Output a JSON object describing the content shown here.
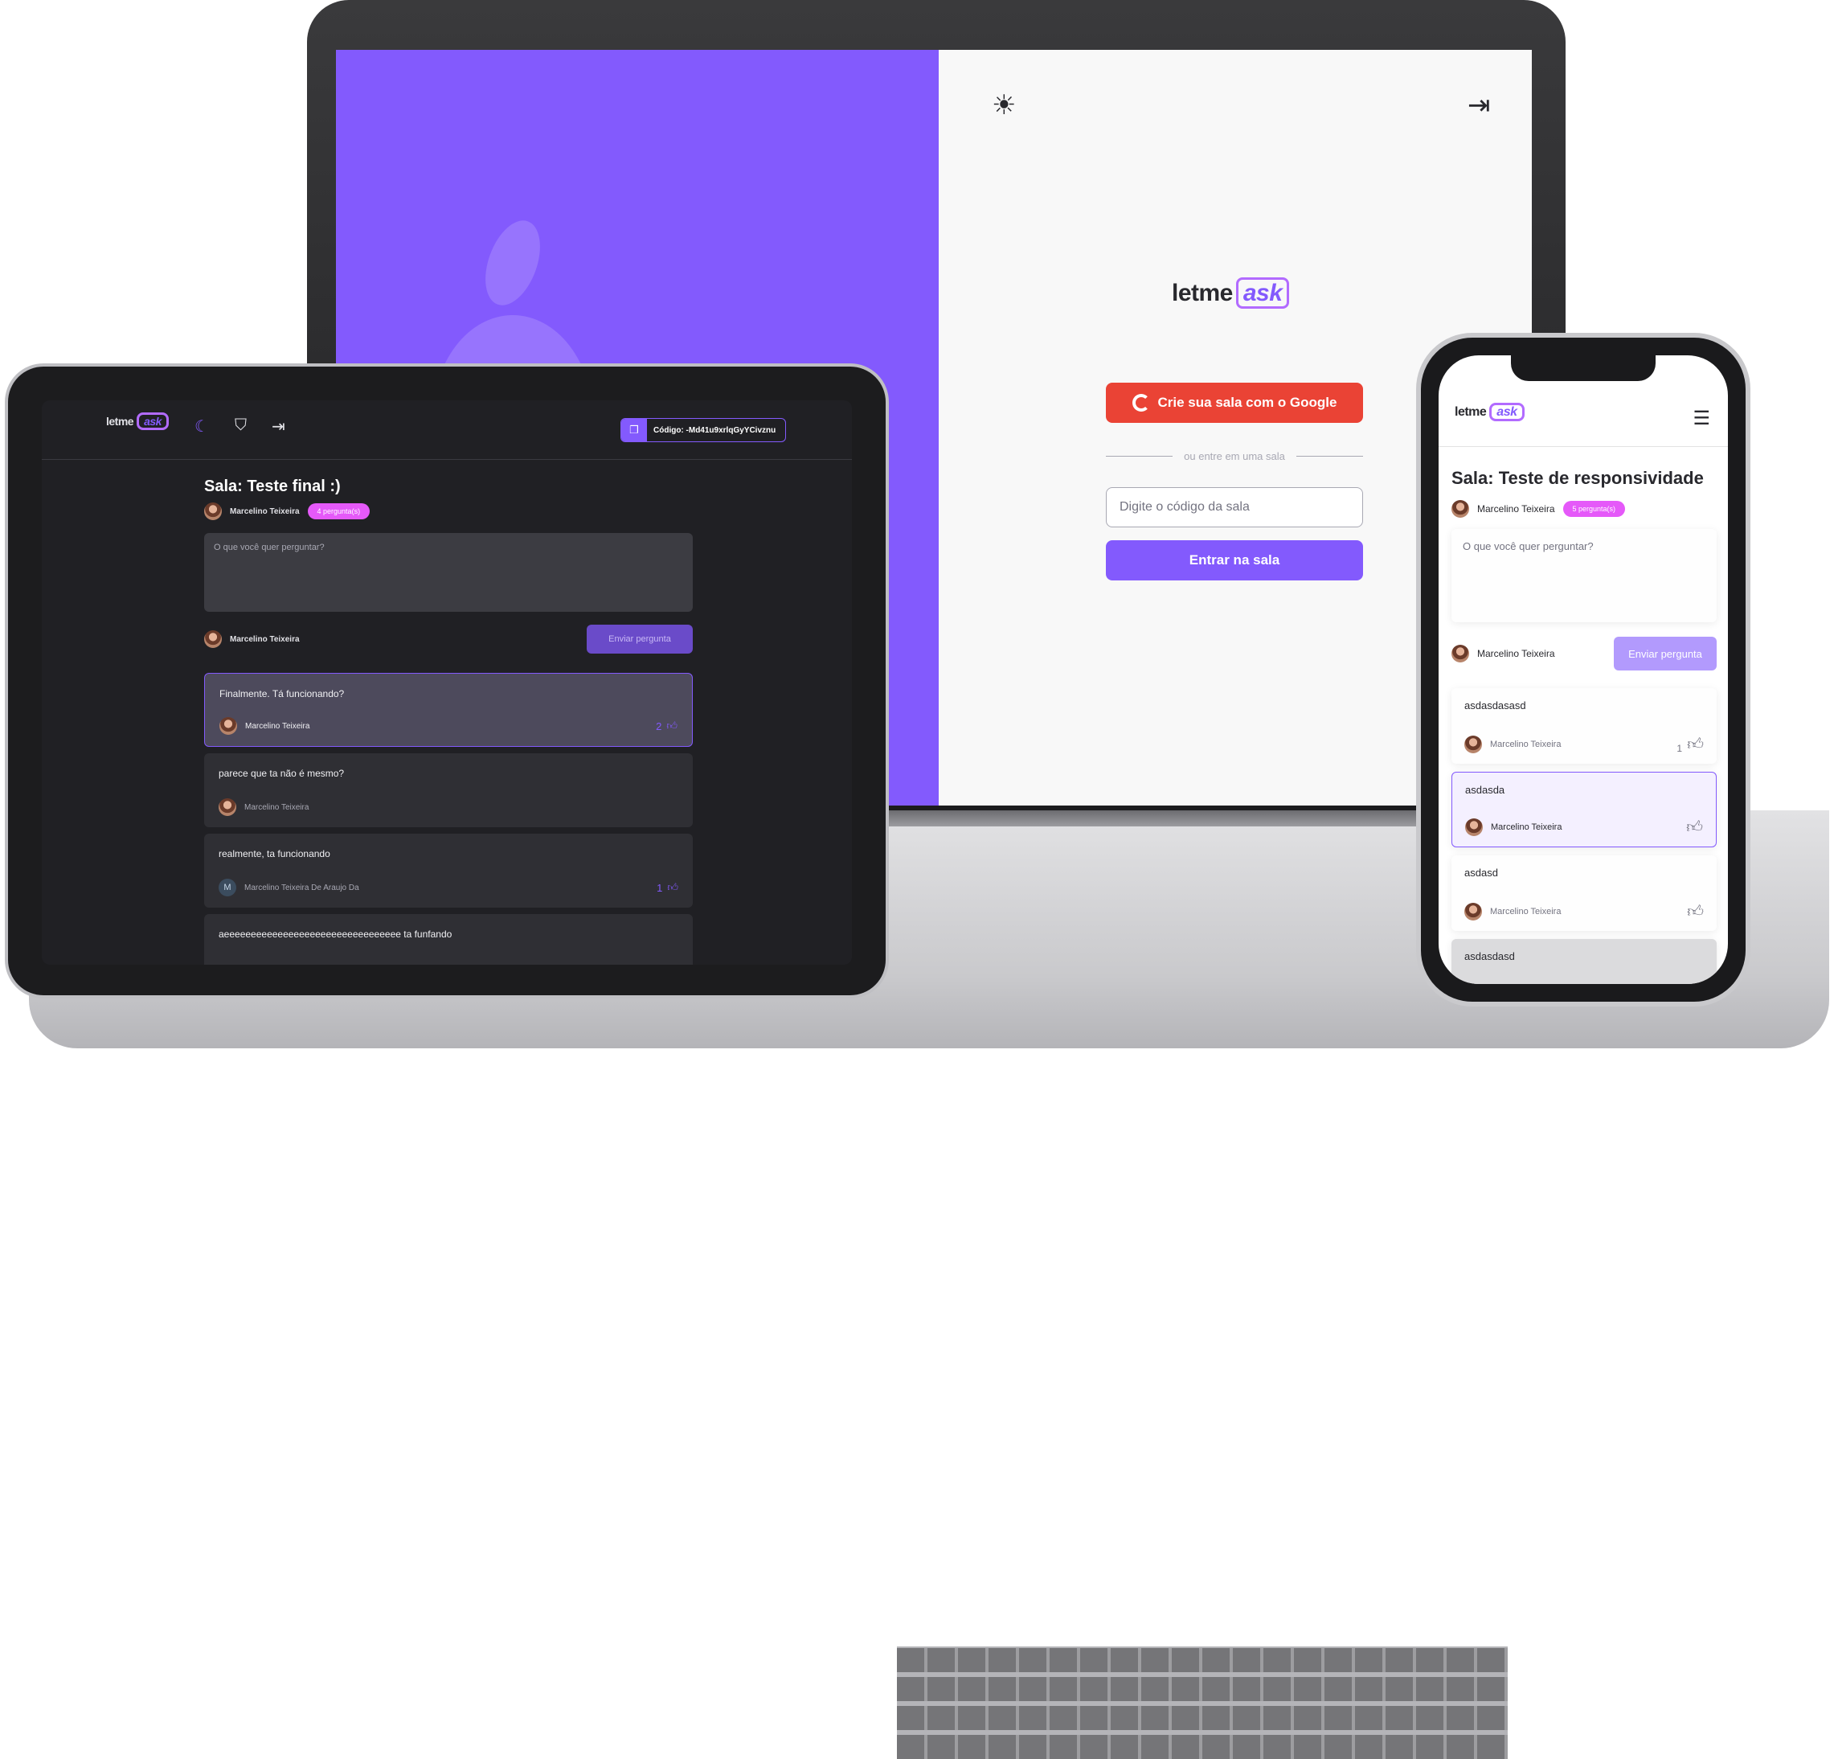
{
  "laptop": {
    "theme_icon": "sun-icon",
    "logout_icon": "logout-icon",
    "logo": {
      "main": "letme",
      "accent": "ask"
    },
    "google_button": "Crie sua sala com o Google",
    "separator": "ou entre em uma sala",
    "code_placeholder": "Digite o código da sala",
    "enter_button": "Entrar na sala",
    "colors": {
      "primary": "#835afd",
      "google": "#ea4335"
    }
  },
  "tablet": {
    "logo": {
      "main": "letme",
      "accent": "ask"
    },
    "header_icons": [
      "moon-icon",
      "shield-icon",
      "logout-icon"
    ],
    "room_code": "Código: -Md41u9xrlqGyYCivznu",
    "title": "Sala: Teste final :)",
    "author": "Marcelino Teixeira",
    "badge": "4 pergunta(s)",
    "textarea_placeholder": "O que você quer perguntar?",
    "form_user": "Marcelino Teixeira",
    "send_button": "Enviar pergunta",
    "questions": [
      {
        "text": "Finalmente. Tá funcionando?",
        "author": "Marcelino Teixeira",
        "likes": "2"
      },
      {
        "text": "parece que ta não é mesmo?",
        "author": "Marcelino Teixeira",
        "likes": ""
      },
      {
        "text": "realmente, ta funcionando",
        "author": "Marcelino Teixeira De Araujo Da",
        "avatar_letter": "M",
        "likes": "1"
      },
      {
        "text": "aeeeeeeeeeeeeeeeeeeeeeeeeeeeeeeeee ta funfando",
        "author": "",
        "likes": ""
      }
    ]
  },
  "phone": {
    "logo": {
      "main": "letme",
      "accent": "ask"
    },
    "menu_icon": "hamburger-icon",
    "title": "Sala: Teste de responsividade",
    "author": "Marcelino Teixeira",
    "badge": "5 pergunta(s)",
    "textarea_placeholder": "O que você quer perguntar?",
    "form_user": "Marcelino Teixeira",
    "send_button": "Enviar pergunta",
    "questions": [
      {
        "text": "asdasdasasd",
        "author": "Marcelino Teixeira",
        "likes": "1"
      },
      {
        "text": "asdasda",
        "author": "Marcelino Teixeira",
        "likes": ""
      },
      {
        "text": "asdasd",
        "author": "Marcelino Teixeira",
        "likes": ""
      },
      {
        "text": "asdasdasd",
        "author": "",
        "likes": ""
      }
    ]
  }
}
